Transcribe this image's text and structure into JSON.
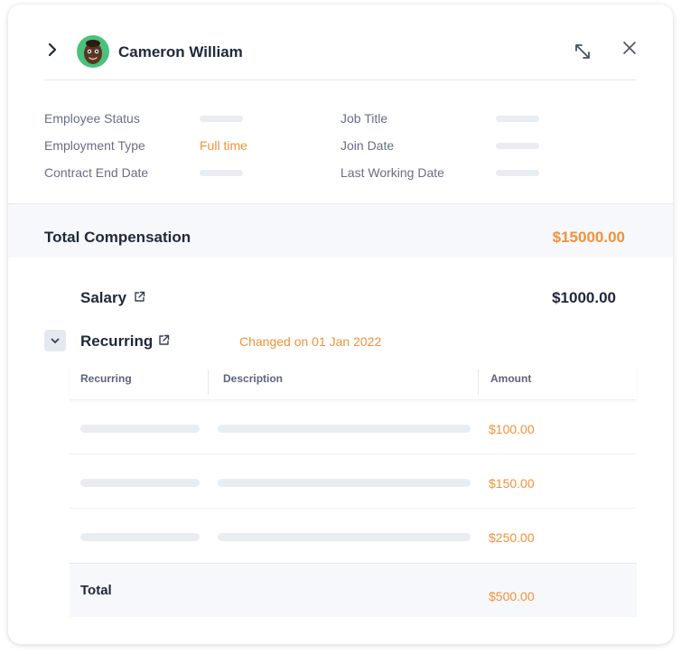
{
  "header": {
    "user_name": "Cameron William",
    "icons": [
      "chevron-right-icon",
      "avatar",
      "expand-icon",
      "close-icon"
    ]
  },
  "details": {
    "employee_status_label": "Employee Status",
    "employment_type_label": "Employment Type",
    "employment_type_value": "Full time",
    "contract_end_date_label": "Contract End Date",
    "job_title_label": "Job Title",
    "join_date_label": "Join Date",
    "last_working_date_label": "Last Working Date"
  },
  "compensation": {
    "total_label": "Total Compensation",
    "total_value": "$15000.00",
    "salary_label": "Salary",
    "salary_value": "$1000.00",
    "recurring_label": "Recurring",
    "recurring_note": "Changed on 01 Jan 2022"
  },
  "recurring_table": {
    "columns": [
      "Recurring",
      "Description",
      "Amount"
    ],
    "rows": [
      {
        "amount": "$100.00"
      },
      {
        "amount": "$150.00"
      },
      {
        "amount": "$250.00"
      }
    ],
    "total_label": "Total",
    "total_amount": "$500.00"
  },
  "colors": {
    "accent": "#f2913a",
    "text": "#1e293b",
    "muted": "#667085",
    "avatar_bg": "#4ac27e",
    "band_bg": "#f6f8fb"
  }
}
